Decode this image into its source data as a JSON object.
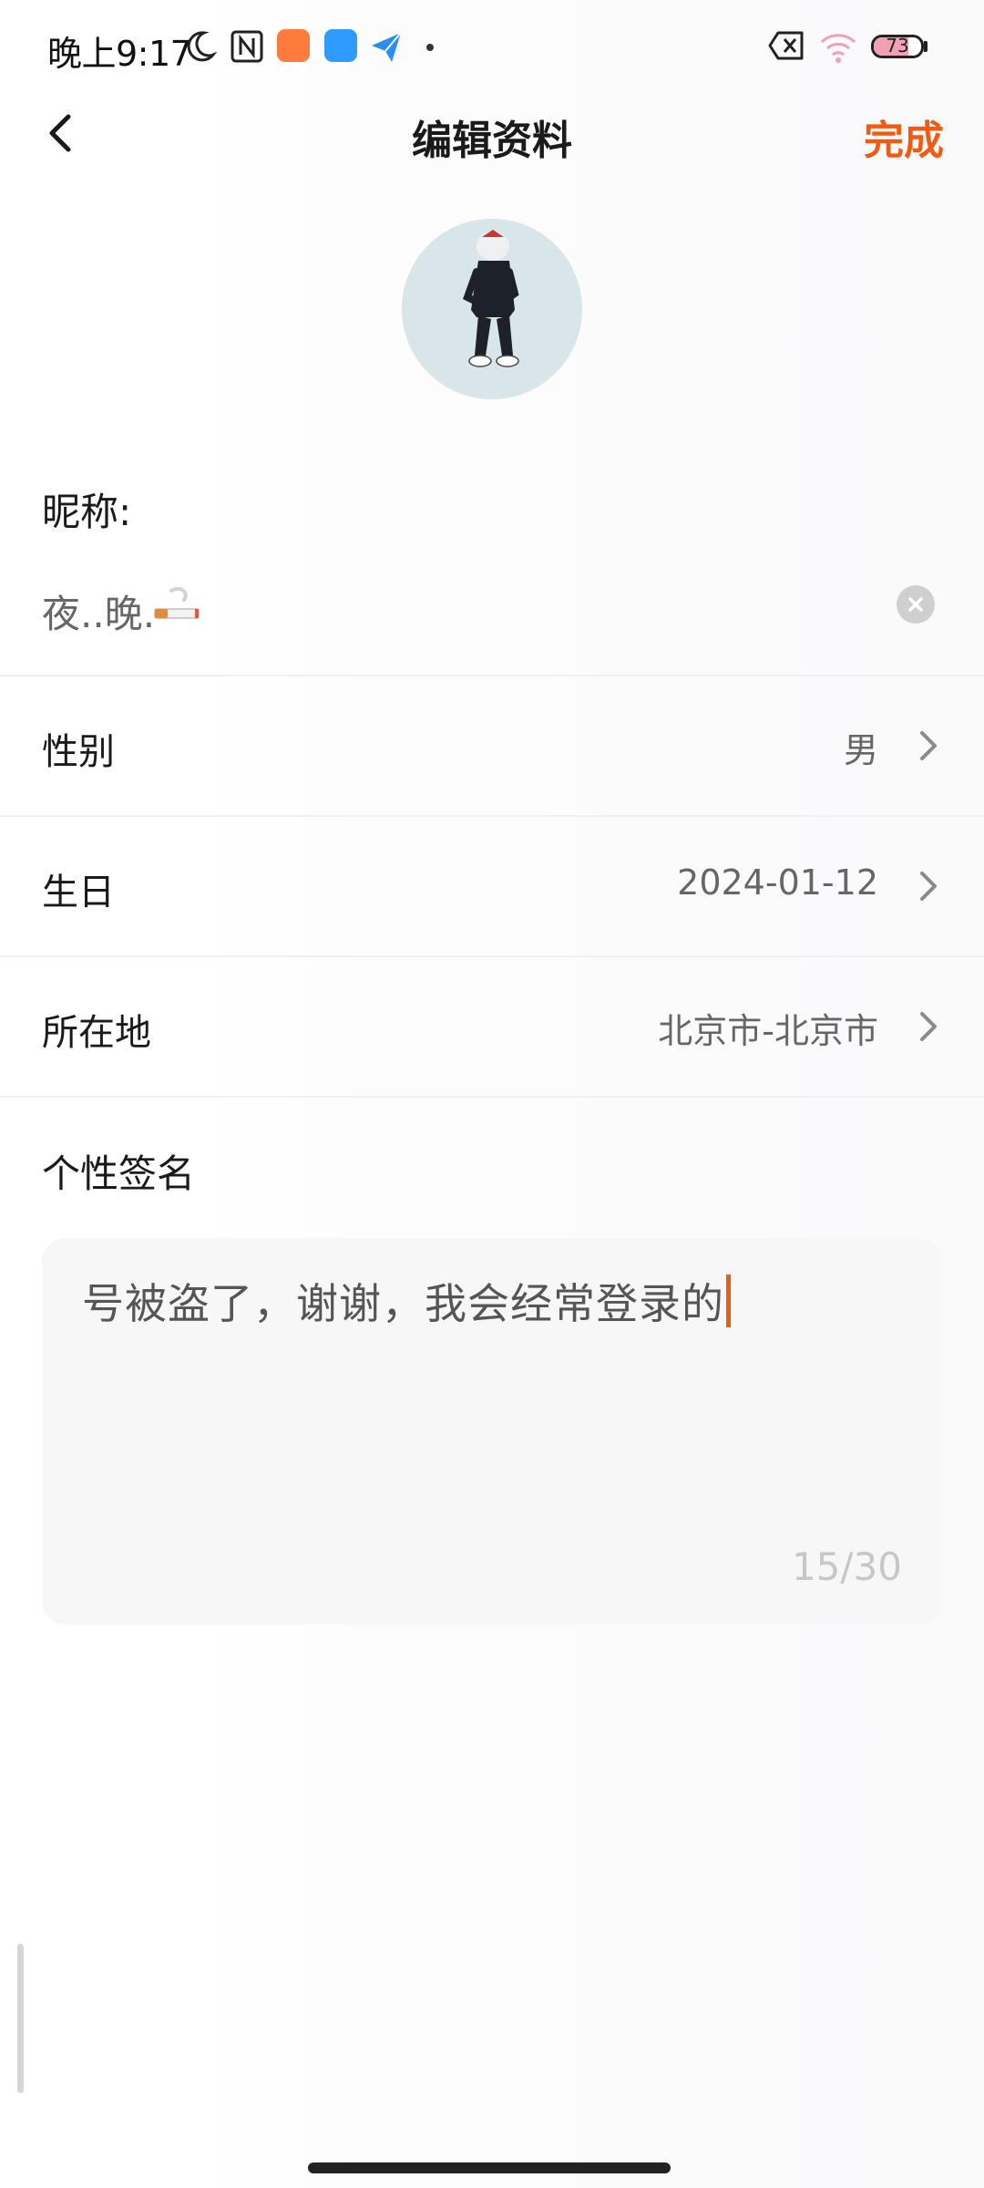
{
  "status_bar": {
    "time": "晚上9:17",
    "battery": "73",
    "battery_level": 0.73,
    "icons": [
      "moon-icon",
      "nfc-icon",
      "shop-app-icon",
      "browser-app-icon",
      "send-app-icon",
      "dot-icon",
      "no-sim-icon",
      "wifi-icon",
      "battery-icon"
    ]
  },
  "header": {
    "title": "编辑资料",
    "done_label": "完成",
    "back_icon": "back-arrow-icon"
  },
  "nickname": {
    "label": "昵称:",
    "value": "夜..晚.",
    "emoji_icon": "cigarette-icon",
    "clear_icon": "clear-icon"
  },
  "rows": [
    {
      "label": "性别",
      "value": "男"
    },
    {
      "label": "生日",
      "value": "2024-01-12"
    },
    {
      "label": "所在地",
      "value": "北京市-北京市"
    }
  ],
  "signature": {
    "label": "个性签名",
    "text": "号被盗了，谢谢，我会经常登录的",
    "count": "15/30"
  },
  "colors": {
    "accent": "#f05a14",
    "secondary_text": "#666666",
    "counter": "#c7c7c7"
  }
}
